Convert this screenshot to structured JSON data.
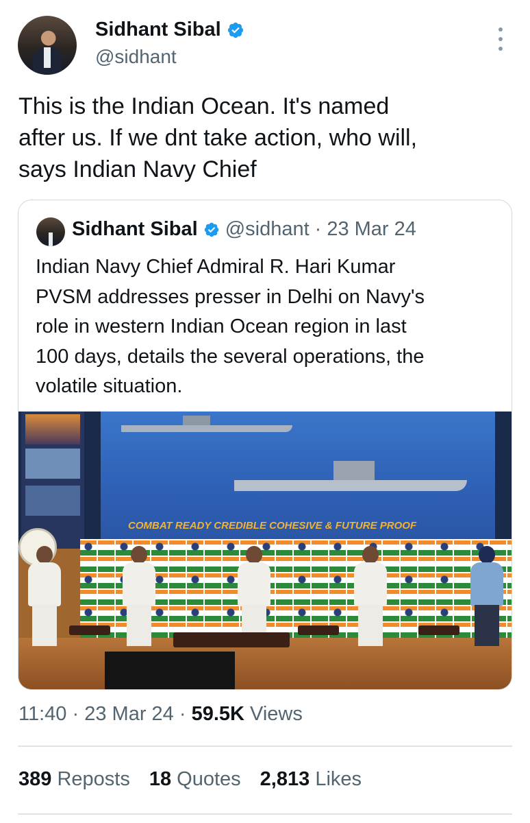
{
  "author": {
    "name": "Sidhant Sibal",
    "handle": "@sidhant",
    "verified": true
  },
  "tweet": {
    "text_line1": "This is the Indian Ocean. It's named",
    "text_line2": "after us. If we dnt take action, who will,",
    "text_line3": "says Indian Navy Chief"
  },
  "quote": {
    "name": "Sidhant Sibal",
    "handle": "@sidhant",
    "separator": "·",
    "date": "23 Mar 24",
    "text_line1": "Indian Navy Chief Admiral R. Hari Kumar",
    "text_line2": "PVSM addresses presser in Delhi on Navy's",
    "text_line3": "role in western Indian Ocean region in last",
    "text_line4": "100 days, details the several operations, the",
    "text_line5": "volatile situation.",
    "image_banner": "COMBAT READY CREDIBLE COHESIVE & FUTURE PROOF"
  },
  "footer": {
    "time": "11:40",
    "sep1": "·",
    "date": "23 Mar 24",
    "sep2": "·",
    "views_count": "59.5K",
    "views_label": "Views"
  },
  "stats": {
    "reposts_count": "389",
    "reposts_label": "Reposts",
    "quotes_count": "18",
    "quotes_label": "Quotes",
    "likes_count": "2,813",
    "likes_label": "Likes"
  },
  "colors": {
    "verified_blue": "#1d9bf0",
    "text_primary": "#0f1419",
    "text_secondary": "#536471",
    "border": "#cfd9de"
  },
  "icons": [
    "verified-badge-icon",
    "more-options-icon"
  ]
}
